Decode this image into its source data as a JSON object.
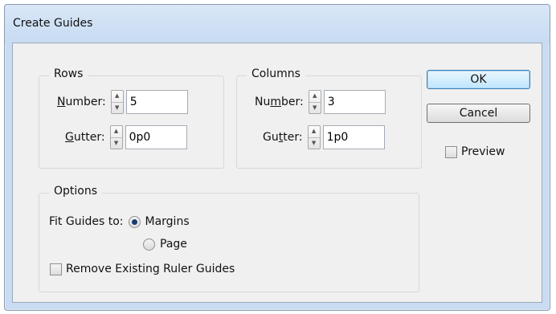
{
  "window": {
    "title": "Create Guides"
  },
  "rows": {
    "group_label": "Rows",
    "number_label_prefix": "",
    "number_label_underlined": "N",
    "number_label_suffix": "umber:",
    "number_value": "5",
    "gutter_label_prefix": "",
    "gutter_label_underlined": "G",
    "gutter_label_suffix": "utter:",
    "gutter_value": "0p0"
  },
  "columns": {
    "group_label": "Columns",
    "number_label_prefix": "Nu",
    "number_label_underlined": "m",
    "number_label_suffix": "ber:",
    "number_value": "3",
    "gutter_label_prefix": "Gu",
    "gutter_label_underlined": "t",
    "gutter_label_suffix": "ter:",
    "gutter_value": "1p0"
  },
  "options": {
    "group_label": "Options",
    "fit_label": "Fit Guides to:",
    "margins_label": "Margins",
    "page_label": "Page",
    "fit_selected": "Margins",
    "remove_label": "Remove Existing Ruler Guides",
    "remove_checked": false
  },
  "buttons": {
    "ok_label": "OK",
    "cancel_label": "Cancel"
  },
  "preview": {
    "label": "Preview",
    "checked": false
  },
  "icons": {
    "spinner_up": "spinner-up-arrow",
    "spinner_down": "spinner-down-arrow"
  }
}
